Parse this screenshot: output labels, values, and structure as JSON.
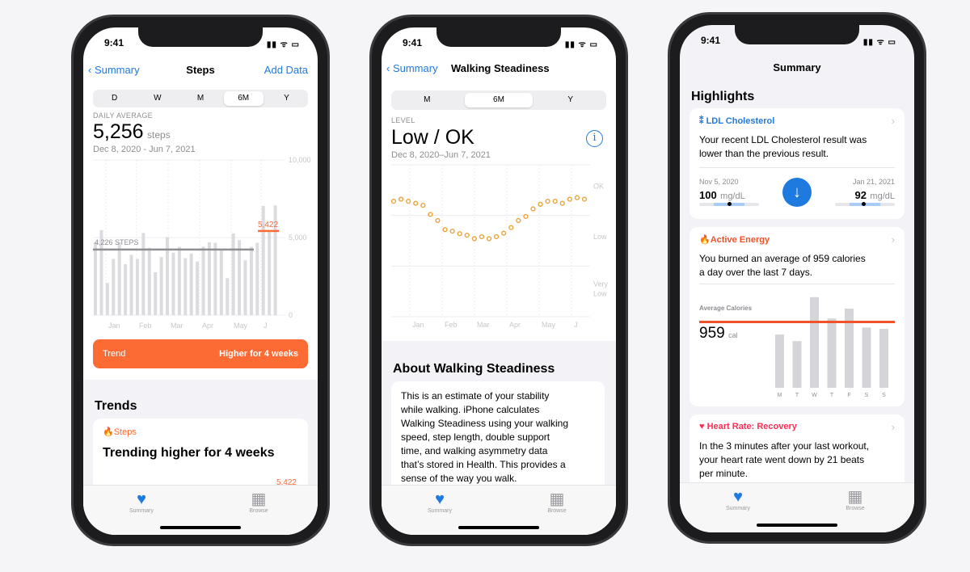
{
  "status": {
    "time": "9:41",
    "signal": "▮▮ ᯤ ▭"
  },
  "phone1": {
    "nav": {
      "back": "Summary",
      "title": "Steps",
      "action": "Add Data"
    },
    "segments": [
      "D",
      "W",
      "M",
      "6M",
      "Y"
    ],
    "selected_segment": "6M",
    "metric_label": "DAILY AVERAGE",
    "value": "5,256",
    "unit": "steps",
    "date_range": "Dec 8, 2020 - Jun 7, 2021",
    "trend_button": {
      "label": "Trend",
      "value": "Higher for 4 weeks"
    },
    "trends_heading": "Trends",
    "trend_card": {
      "category": "Steps",
      "title": "Trending higher for 4 weeks",
      "value": "5,422"
    },
    "tabs": [
      "Summary",
      "Browse"
    ]
  },
  "phone2": {
    "nav": {
      "back": "Summary",
      "title": "Walking Steadiness"
    },
    "segments": [
      "M",
      "6M",
      "Y"
    ],
    "selected_segment": "6M",
    "metric_label": "LEVEL",
    "value": "Low / OK",
    "date_range": "Dec 8, 2020–Jun 7, 2021",
    "about_heading": "About Walking Steadiness",
    "about_lines": [
      "This is an estimate of your stability",
      "while walking. iPhone calculates",
      "Walking Steadiness using your walking",
      "speed, step length, double support",
      "time, and walking asymmetry data",
      "that’s stored in Health. This provides a",
      "sense of the way you walk."
    ],
    "tabs": [
      "Summary",
      "Browse"
    ]
  },
  "phone3": {
    "nav": {
      "title": "Summary"
    },
    "highlights_heading": "Highlights",
    "ldl": {
      "title": "LDL Cholesterol",
      "lines": [
        "Your recent LDL Cholesterol result was",
        "lower than the previous result."
      ],
      "prev": {
        "date": "Nov 5, 2020",
        "value": "100",
        "unit": "mg/dL"
      },
      "curr": {
        "date": "Jan 21, 2021",
        "value": "92",
        "unit": "mg/dL"
      }
    },
    "energy": {
      "title": "Active Energy",
      "lines": [
        "You burned an average of 959 calories",
        "a day over the last 7 days."
      ],
      "avg_label": "Average Calories",
      "value": "959",
      "unit": "cal"
    },
    "heart": {
      "title": "Heart Rate: Recovery",
      "lines": [
        "In the 3 minutes after your last workout,",
        "your heart rate went down by 21 beats",
        "per minute."
      ]
    },
    "tabs": [
      "Summary",
      "Browse"
    ]
  },
  "colors": {
    "accent": "#1f7ae0",
    "steps_orange": "#fd6b35",
    "steadiness_dot": "#e9a33b",
    "energy_red": "#f0522a",
    "heart_red": "#ff2d55",
    "bar_gray": "#dcdce0"
  },
  "chart_data": [
    {
      "type": "bar",
      "title": "Steps",
      "ylim": [
        0,
        10000
      ],
      "yticks": [
        "10,000",
        "5,000",
        "0"
      ],
      "xticks": [
        "Jan",
        "Feb",
        "Mar",
        "Apr",
        "May",
        "J"
      ],
      "values": [
        4690,
        5480,
        2070,
        3620,
        4700,
        3280,
        3880,
        3620,
        5290,
        4340,
        2760,
        3740,
        5030,
        4020,
        4400,
        3670,
        3970,
        3450,
        4400,
        4700,
        4660,
        4260,
        2380,
        5260,
        4830,
        3530,
        4400,
        4660,
        7030,
        5430,
        7070
      ],
      "reference_lines": [
        {
          "label": "4,226 STEPS",
          "value": 4226
        },
        {
          "label": "5,422",
          "value": 5422
        }
      ]
    },
    {
      "type": "scatter",
      "title": "Walking Steadiness",
      "y_categories": [
        "OK",
        "Low",
        "Very Low"
      ],
      "xticks": [
        "Jan",
        "Feb",
        "Mar",
        "Apr",
        "May",
        "J"
      ],
      "values": [
        2.28,
        2.32,
        2.28,
        2.24,
        2.2,
        2.02,
        1.9,
        1.72,
        1.69,
        1.64,
        1.61,
        1.54,
        1.58,
        1.54,
        1.58,
        1.65,
        1.76,
        1.9,
        1.98,
        2.13,
        2.22,
        2.28,
        2.28,
        2.24,
        2.32,
        2.35,
        2.32
      ]
    },
    {
      "type": "bar",
      "title": "Active Energy",
      "categories": [
        "M",
        "T",
        "W",
        "T",
        "F",
        "S",
        "S"
      ],
      "values": [
        776,
        680,
        1320,
        1010,
        1153,
        877,
        858
      ],
      "average": 959
    }
  ]
}
